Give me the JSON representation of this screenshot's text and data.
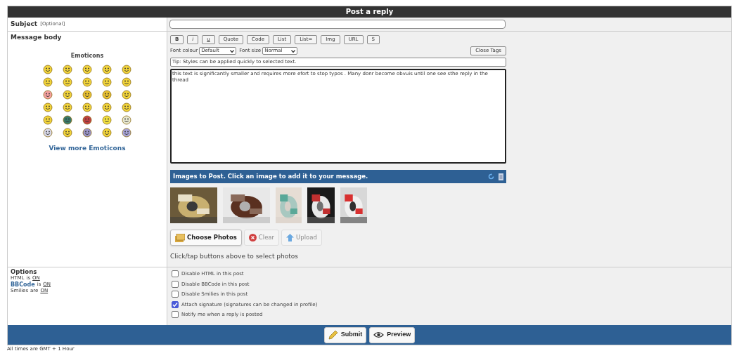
{
  "header": {
    "title": "Post a reply"
  },
  "subject": {
    "label": "Subject",
    "hint": "[Optional]"
  },
  "message": {
    "label": "Message body",
    "emoticons_title": "Emoticons",
    "view_more": "View more Emoticons",
    "format_buttons": [
      "B",
      "i",
      "u",
      "Quote",
      "Code",
      "List",
      "List=",
      "Img",
      "URL",
      "S"
    ],
    "font_colour": {
      "label": "Font colour",
      "value": "Default"
    },
    "font_size": {
      "label": "Font size",
      "value": "Normal"
    },
    "close_tags": "Close Tags",
    "tip": "Tip: Styles can be applied quickly to selected text.",
    "body": "this text is significantly smaller and requires more efort to stop typos . Many donr become obvuis until one see sthe reply in the thread"
  },
  "images": {
    "title": "Images to Post. Click an image to add it to your message.",
    "buttons": [
      {
        "label": "Choose Photos",
        "kind": "choose",
        "disabled": false
      },
      {
        "label": "Clear",
        "kind": "clear",
        "disabled": true
      },
      {
        "label": "Upload",
        "kind": "upload",
        "disabled": true
      }
    ],
    "hint": "Click/tap buttons above to select photos"
  },
  "options": {
    "label": "Options",
    "info": [
      {
        "name": "HTML",
        "name_link": false,
        "verb": "is",
        "value": "ON"
      },
      {
        "name": "BBCode",
        "name_link": true,
        "verb": "is",
        "value": "ON"
      },
      {
        "name": "Smilies",
        "name_link": false,
        "verb": "are",
        "value": "ON"
      }
    ],
    "checkboxes": [
      {
        "label": "Disable HTML in this post",
        "checked": false
      },
      {
        "label": "Disable BBCode in this post",
        "checked": false
      },
      {
        "label": "Disable Smilies in this post",
        "checked": false
      },
      {
        "label": "Attach signature (signatures can be changed in profile)",
        "checked": true
      },
      {
        "label": "Notify me when a reply is posted",
        "checked": false
      }
    ]
  },
  "actions": [
    {
      "label": "Submit",
      "kind": "submit"
    },
    {
      "label": "Preview",
      "kind": "preview"
    }
  ],
  "footer": "All times are GMT + 1 Hour"
}
